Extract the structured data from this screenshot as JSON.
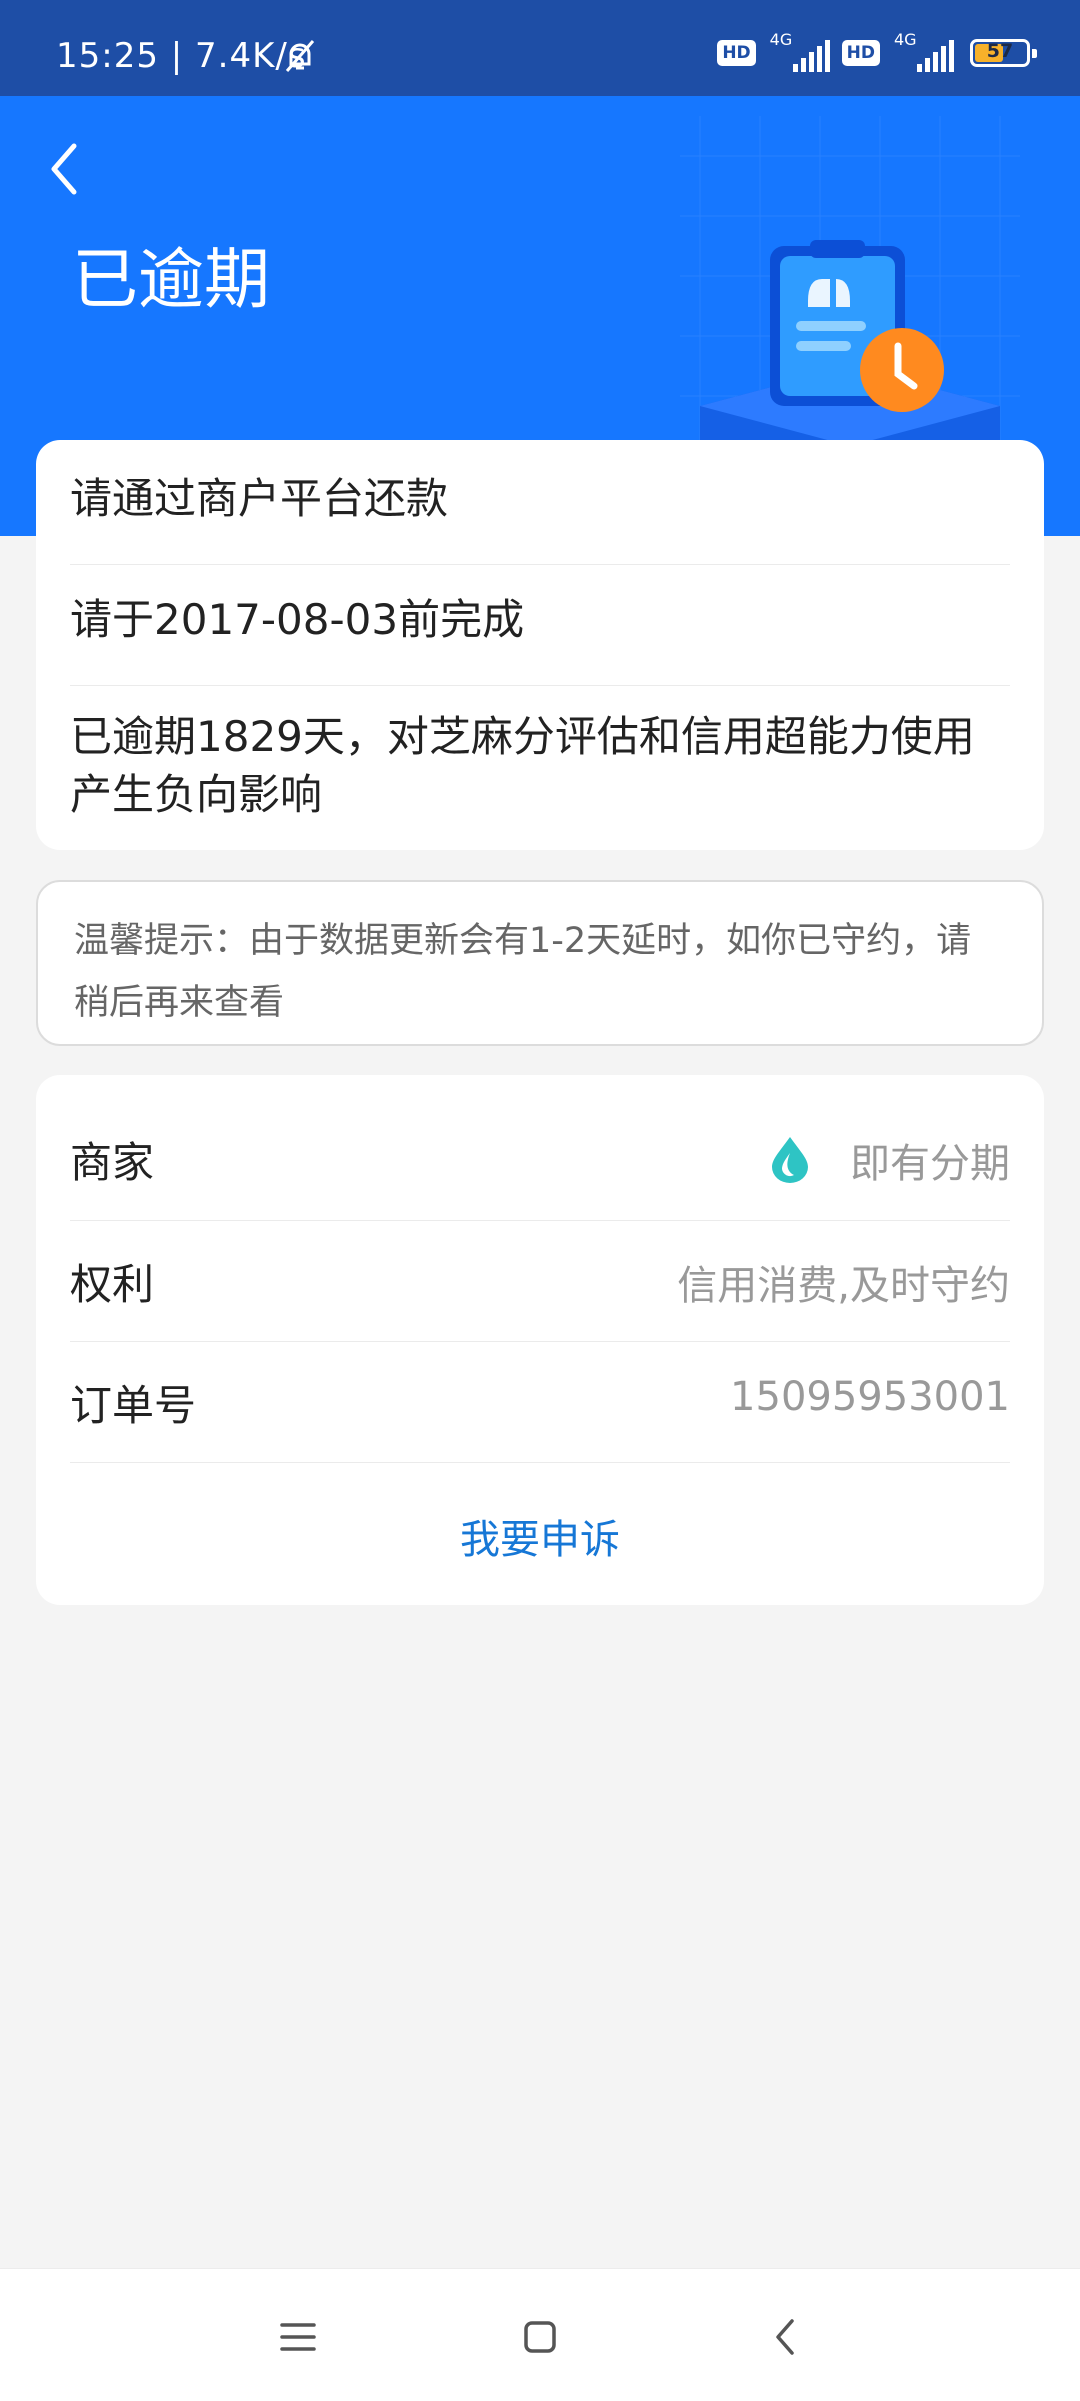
{
  "status_bar": {
    "time_speed": "15:25 | 7.4K/s",
    "hd_1": "HD",
    "net_1": "4G",
    "hd_2": "HD",
    "net_2": "4G",
    "battery": "57"
  },
  "header": {
    "title": "已逾期"
  },
  "notice_card": {
    "line1": "请通过商户平台还款",
    "line2": "请于2017-08-03前完成",
    "line3": "已逾期1829天，对芝麻分评估和信用超能力使用产生负向影响"
  },
  "tip": {
    "text": "温馨提示：由于数据更新会有1-2天延时，如你已守约，请稍后再来查看"
  },
  "details": {
    "merchant_label": "商家",
    "merchant_value": "即有分期",
    "rights_label": "权利",
    "rights_value": "信用消费,及时守约",
    "order_label": "订单号",
    "order_value": "15095953001",
    "appeal": "我要申诉"
  },
  "colors": {
    "header_blue": "#1677ff",
    "status_bar": "#1e4ea6",
    "link_blue": "#1677d6",
    "accent_orange": "#ff8a1f",
    "merchant_icon_teal": "#2ec4c4"
  },
  "icons": [
    "mute-icon",
    "back-arrow-icon",
    "clipboard-clock-icon",
    "merchant-drop-icon",
    "menu-icon",
    "home-icon",
    "nav-back-icon"
  ]
}
